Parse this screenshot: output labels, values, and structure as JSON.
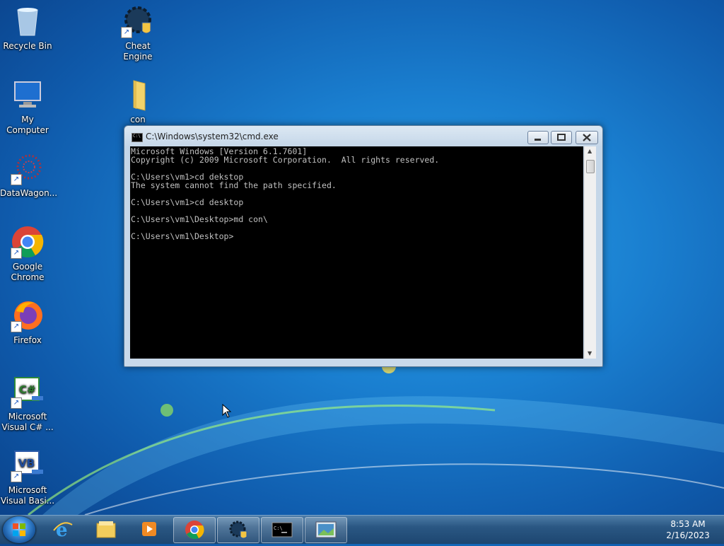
{
  "desktop": {
    "icons": [
      {
        "label": "Recycle Bin",
        "icon": "recycle-bin-icon"
      },
      {
        "label": "Cheat Engine",
        "icon": "cheat-engine-icon"
      },
      {
        "label": "My Computer",
        "icon": "computer-icon"
      },
      {
        "label": "con",
        "icon": "folder-icon"
      },
      {
        "label": "DataWagon...",
        "icon": "datawagon-icon"
      },
      {
        "label": "Google\nChrome",
        "icon": "chrome-icon"
      },
      {
        "label": "Firefox",
        "icon": "firefox-icon"
      },
      {
        "label": "Microsoft\nVisual C# ...",
        "icon": "visual-csharp-icon"
      },
      {
        "label": "Microsoft\nVisual Basi...",
        "icon": "visual-basic-icon"
      }
    ]
  },
  "cmd_window": {
    "title": "C:\\Windows\\system32\\cmd.exe",
    "lines": [
      "Microsoft Windows [Version 6.1.7601]",
      "Copyright (c) 2009 Microsoft Corporation.  All rights reserved.",
      "",
      "C:\\Users\\vm1>cd dekstop",
      "The system cannot find the path specified.",
      "",
      "C:\\Users\\vm1>cd desktop",
      "",
      "C:\\Users\\vm1\\Desktop>md con\\",
      "",
      "C:\\Users\\vm1\\Desktop>"
    ]
  },
  "taskbar": {
    "items": [
      "internet-explorer-icon",
      "windows-explorer-icon",
      "media-player-icon",
      "chrome-icon",
      "cheat-engine-icon",
      "cmd-icon",
      "image-viewer-icon"
    ],
    "clock_time": "8:53 AM",
    "clock_date": "2/16/2023"
  },
  "colors": {
    "desktop_blue": "#1a7fd0",
    "console_bg": "#000000",
    "console_fg": "#c0c0c0"
  }
}
